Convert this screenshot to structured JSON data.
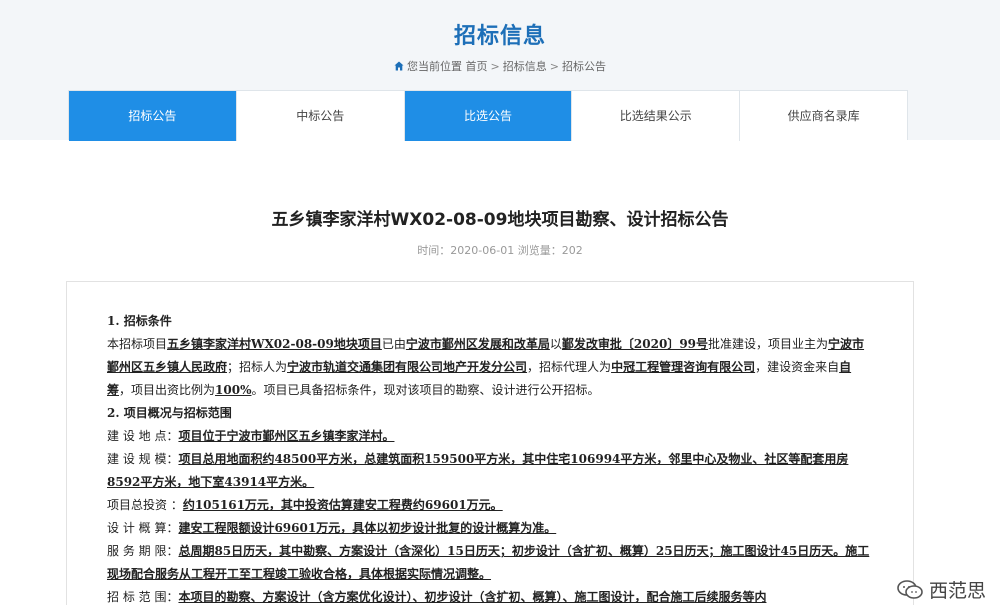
{
  "header": {
    "title": "招标信息",
    "breadcrumb": {
      "prefix": "您当前位置",
      "items": [
        "首页",
        "招标信息",
        "招标公告"
      ],
      "separator": ">"
    }
  },
  "tabs": [
    {
      "label": "招标公告",
      "active": true
    },
    {
      "label": "中标公告",
      "active": false
    },
    {
      "label": "比选公告",
      "active": true
    },
    {
      "label": "比选结果公示",
      "active": false
    },
    {
      "label": "供应商名录库",
      "active": false
    }
  ],
  "article": {
    "title": "五乡镇李家洋村WX02-08-09地块项目勘察、设计招标公告",
    "meta": "时间：2020-06-01  浏览量：202",
    "s1_heading": "1. 招标条件",
    "s1_t1": "本招标项目",
    "s1_u1": "五乡镇李家洋村WX02-08-09地块项目",
    "s1_t2": "已由",
    "s1_u2": "宁波市鄞州区发展和改革局",
    "s1_t3": "以",
    "s1_u3": "鄞发改审批〔2020〕99号",
    "s1_t4": "批准建设，项目业主为",
    "s1_u4": "宁波市鄞州区五乡镇人民政府",
    "s1_t5": "；招标人为",
    "s1_u5": "宁波市轨道交通集团有限公司地产开发分公司",
    "s1_t6": "，招标代理人为",
    "s1_u6": "中冠工程管理咨询有限公司",
    "s1_t7": "，建设资金来自",
    "s1_u7": "自筹",
    "s1_t8": "，项目出资比例为",
    "s1_u8": "100%",
    "s1_t9": "。项目已具备招标条件，现对该项目的勘察、设计进行公开招标。",
    "s2_heading": "2. 项目概况与招标范围",
    "loc_label": "建 设 地 点：",
    "loc_value": "项目位于宁波市鄞州区五乡镇李家洋村。",
    "scale_label": "建 设 规 模：",
    "scale_value": "项目总用地面积约48500平方米，总建筑面积159500平方米，其中住宅106994平方米，邻里中心及物业、社区等配套用房8592平方米，地下室43914平方米。",
    "inv_label": "项目总投资 ：",
    "inv_value": "约105161万元，其中投资估算建安工程费约69601万元。",
    "design_label": "设 计 概 算：",
    "design_value": "建安工程限额设计69601万元，具体以初步设计批复的设计概算为准。",
    "period_label": "服 务 期 限：",
    "period_value": "总周期85日历天，其中勘察、方案设计（含深化）15日历天；初步设计（含扩初、概算）25日历天；施工图设计45日历天。施工现场配合服务从工程开工至工程竣工验收合格，具体根据实际情况调整。",
    "scope_label": "招 标 范 围：",
    "scope_value": "本项目的勘察、方案设计（含方案优化设计）、初步设计（含扩初、概算）、施工图设计，配合施工后续服务等内"
  },
  "watermark": {
    "text": "西范思"
  },
  "colors": {
    "accent": "#1f8ee6",
    "title_blue": "#1d6fb8",
    "banner_bg": "#f3f6f9"
  }
}
